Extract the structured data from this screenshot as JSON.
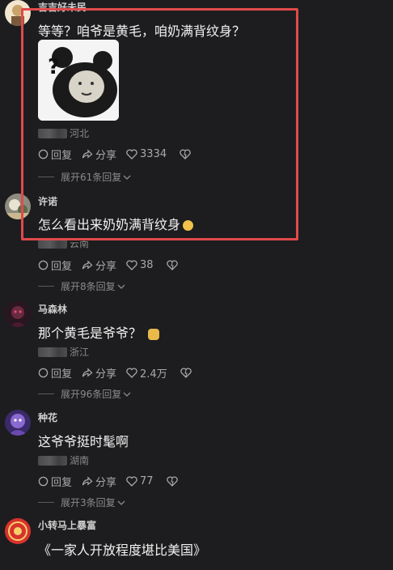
{
  "comments": [
    {
      "username": "吉吉好未民",
      "text": "等等？咱爷是黄毛，咱奶满背纹身？",
      "location": "河北",
      "reply_label": "回复",
      "share_label": "分享",
      "likes": "3334",
      "expand_label": "展开61条回复"
    },
    {
      "username": "许诺",
      "text": "怎么看出来奶奶满背纹身",
      "location": "云南",
      "reply_label": "回复",
      "share_label": "分享",
      "likes": "38",
      "expand_label": "展开8条回复"
    },
    {
      "username": "马森林",
      "text": "那个黄毛是爷爷？",
      "location": "浙江",
      "reply_label": "回复",
      "share_label": "分享",
      "likes": "2.4万",
      "expand_label": "展开96条回复"
    },
    {
      "username": "种花",
      "text": "这爷爷挺时髦啊",
      "location": "湖南",
      "reply_label": "回复",
      "share_label": "分享",
      "likes": "77",
      "expand_label": "展开3条回复"
    },
    {
      "username": "小转马上暴富",
      "text": "《一家人开放程度堪比美国》"
    }
  ],
  "colors": {
    "background": "#1d1d1f",
    "highlight": "#e04a4a",
    "secondary_text": "#8a8a8a"
  },
  "icons": [
    "reply-icon",
    "share-icon",
    "heart-icon",
    "dislike-icon",
    "chevron-down-icon"
  ]
}
